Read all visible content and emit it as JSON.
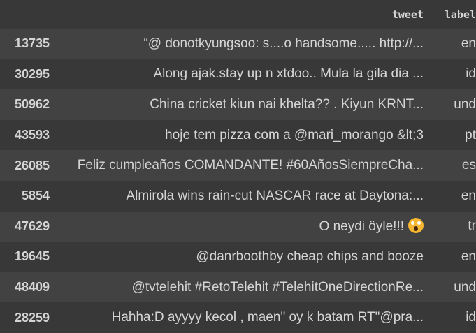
{
  "table": {
    "columns": [
      "",
      "tweet",
      "label"
    ],
    "rows": [
      {
        "index": "13735",
        "tweet": "“@ donotkyungsoo: s....o handsome..... http://...",
        "label": "en"
      },
      {
        "index": "30295",
        "tweet": "Along ajak.stay up n xtdoo.. Mula la gila dia ...",
        "label": "id"
      },
      {
        "index": "50962",
        "tweet": "China cricket kiun nai khelta?? . Kiyun KRNT...",
        "label": "und"
      },
      {
        "index": "43593",
        "tweet": "hoje tem pizza com a @mari_morango &lt;3",
        "label": "pt"
      },
      {
        "index": "26085",
        "tweet": "Feliz cumpleaños COMANDANTE! #60AñosSiempreCha...",
        "label": "es"
      },
      {
        "index": "5854",
        "tweet": "Almirola wins rain-cut NASCAR race at Daytona:...",
        "label": "en"
      },
      {
        "index": "47629",
        "tweet": "O neydi öyle!!!",
        "label": "tr",
        "emoji": "face-screaming-in-fear-icon"
      },
      {
        "index": "19645",
        "tweet": "@danrboothby cheap chips and booze",
        "label": "en"
      },
      {
        "index": "48409",
        "tweet": "@tvtelehit #RetoTelehit #TelehitOneDirectionRe...",
        "label": "und"
      },
      {
        "index": "28259",
        "tweet": "Hahha:D ayyyy kecol , maen\" oy k batam RT\"@pra...",
        "label": "id"
      }
    ]
  }
}
